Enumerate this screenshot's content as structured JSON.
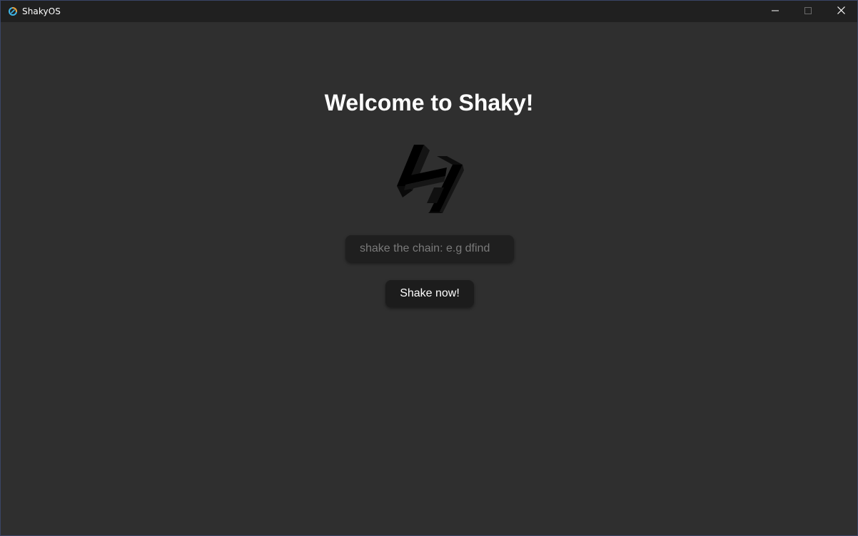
{
  "window": {
    "title": "ShakyOS",
    "app_icon": "shaky-app-icon",
    "controls": {
      "minimize_icon": "minimize-icon",
      "maximize_icon": "maximize-icon",
      "close_icon": "close-icon"
    }
  },
  "main": {
    "heading": "Welcome to Shaky!",
    "logo_icon": "shaky-logo",
    "chain_input": {
      "value": "",
      "placeholder": "shake the chain: e.g dfind"
    },
    "shake_button_label": "Shake now!"
  },
  "colors": {
    "background": "#2f2f2f",
    "titlebar": "#202020",
    "input_background": "#1f1f1f",
    "button_background": "#1c1c1c",
    "text": "#ffffff"
  }
}
